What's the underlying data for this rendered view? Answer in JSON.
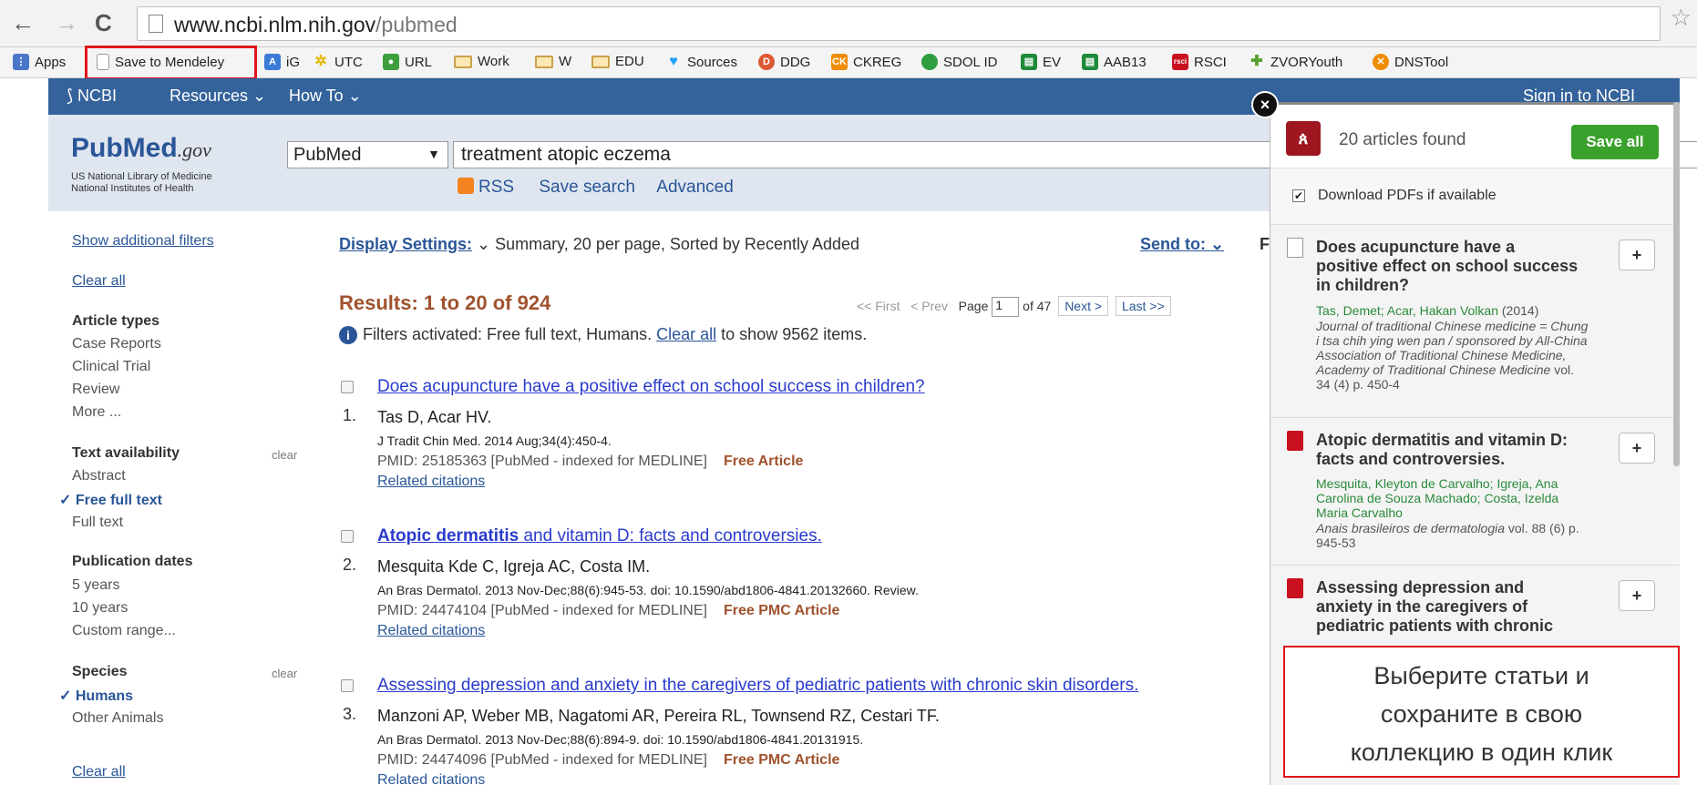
{
  "browser": {
    "url_host": "www.ncbi.nlm.nih.gov",
    "url_path": "/pubmed",
    "bookmarks": [
      {
        "label": "Apps",
        "icon": "apps-grid-icon"
      },
      {
        "label": "Save to Mendeley",
        "icon": "page-icon"
      },
      {
        "label": "iG",
        "icon": "translate-icon"
      },
      {
        "label": "UTC",
        "icon": "sun-icon"
      },
      {
        "label": "URL",
        "icon": "url-icon"
      },
      {
        "label": "Work",
        "icon": "folder-icon"
      },
      {
        "label": "W",
        "icon": "folder-icon"
      },
      {
        "label": "EDU",
        "icon": "folder-icon"
      },
      {
        "label": "Sources",
        "icon": "twitter-icon"
      },
      {
        "label": "DDG",
        "icon": "duckduckgo-icon"
      },
      {
        "label": "CKREG",
        "icon": "ck-icon"
      },
      {
        "label": "SDOL ID",
        "icon": "circle-icon"
      },
      {
        "label": "EV",
        "icon": "sheet-icon"
      },
      {
        "label": "AAB13",
        "icon": "sheet-icon"
      },
      {
        "label": "RSCI",
        "icon": "rsci-icon"
      },
      {
        "label": "ZVORYouth",
        "icon": "puzzle-icon"
      },
      {
        "label": "DNSTool",
        "icon": "dnstool-icon"
      }
    ]
  },
  "ncbi": {
    "logo": "NCBI",
    "resources": "Resources",
    "howto": "How To",
    "signin": "Sign in to NCBI"
  },
  "pubmed": {
    "logo_a": "Pub",
    "logo_b": "Med",
    ".gov": ".gov",
    "logo_gov": ".gov",
    "sub1": "US National Library of Medicine",
    "sub2": "National Institutes of Health",
    "db": "PubMed",
    "query": "treatment atopic eczema",
    "rss": "RSS",
    "save_search": "Save search",
    "advanced": "Advanced"
  },
  "sidebar": {
    "show_filters": "Show additional filters",
    "clear_all": "Clear all",
    "article_types": "Article types",
    "case_reports": "Case Reports",
    "clinical_trial": "Clinical Trial",
    "review": "Review",
    "more": "More ...",
    "text_avail": "Text availability",
    "clear": "clear",
    "abstract": "Abstract",
    "free_full": "Free full text",
    "full_text": "Full text",
    "pub_dates": "Publication dates",
    "y5": "5 years",
    "y10": "10 years",
    "custom": "Custom range...",
    "species": "Species",
    "humans": "Humans",
    "other_animals": "Other Animals",
    "clear_all_bottom": "Clear all"
  },
  "results": {
    "display_settings": "Display Settings:",
    "display_desc": "Summary, 20 per page, Sorted by Recently Added",
    "send_to": "Send to:",
    "heading": "Results: 1 to 20 of 924",
    "first": "<< First",
    "prev": "< Prev",
    "page_label": "Page",
    "page": "1",
    "of": "of 47",
    "next": "Next >",
    "last": "Last >>",
    "filters_pre": "Filters activated: Free full text, Humans.",
    "filters_link": "Clear all",
    "filters_post": "to show 9562 items.",
    "right_col": "Fi"
  },
  "articles": [
    {
      "num": "1.",
      "title_bold": "",
      "title": "Does acupuncture have a positive effect on school success in children?",
      "authors": "Tas D, Acar HV.",
      "journal": "J Tradit Chin Med. 2014 Aug;34(4):450-4.",
      "pmid": "PMID: 25185363 [PubMed - indexed for MEDLINE]",
      "free": "Free Article",
      "related": "Related citations"
    },
    {
      "num": "2.",
      "title_bold": "Atopic dermatitis",
      "title": " and vitamin D: facts and controversies.",
      "authors": "Mesquita Kde C, Igreja AC, Costa IM.",
      "journal": "An Bras Dermatol. 2013 Nov-Dec;88(6):945-53. doi: 10.1590/abd1806-4841.20132660. Review.",
      "pmid": "PMID: 24474104 [PubMed - indexed for MEDLINE]",
      "free": "Free PMC Article",
      "related": "Related citations"
    },
    {
      "num": "3.",
      "title_bold": "",
      "title": "Assessing depression and anxiety in the caregivers of pediatric patients with chronic skin disorders.",
      "authors": "Manzoni AP, Weber MB, Nagatomi AR, Pereira RL, Townsend RZ, Cestari TF.",
      "journal": "An Bras Dermatol. 2013 Nov-Dec;88(6):894-9. doi: 10.1590/abd1806-4841.20131915.",
      "pmid": "PMID: 24474096 [PubMed - indexed for MEDLINE]",
      "free": "Free PMC Article",
      "related": "Related citations"
    }
  ],
  "mendeley": {
    "found": "20 articles found",
    "save_all": "Save all",
    "download_pdfs": "Download PDFs if available",
    "plus": "+",
    "close": "×",
    "items": [
      {
        "title": "Does acupuncture have a positive effect on school success in children?",
        "authors": "Tas, Demet;  Acar, Hakan Volkan",
        "year": "(2014)",
        "journal": "Journal of traditional Chinese medicine = Chung i tsa chih ying wen pan / sponsored by All-China Association of Traditional Chinese Medicine, Academy of Traditional Chinese Medicine",
        "vol": "vol. 34 (4) p. 450-4"
      },
      {
        "title": "Atopic dermatitis and vitamin D: facts and controversies.",
        "authors": "Mesquita, Kleyton de Carvalho;  Igreja, Ana Carolina de Souza Machado;  Costa, Izelda Maria Carvalho",
        "year": "",
        "journal": "Anais brasileiros de dermatologia",
        "vol": "vol. 88 (6) p. 945-53"
      },
      {
        "title": "Assessing depression and anxiety in the caregivers of pediatric patients with chronic",
        "authors": "",
        "year": "",
        "journal": "",
        "vol": ""
      }
    ]
  },
  "tooltip": {
    "line1": "Выберите статьи и",
    "line2": "сохраните в свою",
    "line3": "коллекцию в один клик"
  },
  "colors": {
    "ncbi_blue": "#34639b",
    "mendeley_red": "#9d1620",
    "save_green": "#3aa12c",
    "highlight_red": "#e0161c"
  }
}
